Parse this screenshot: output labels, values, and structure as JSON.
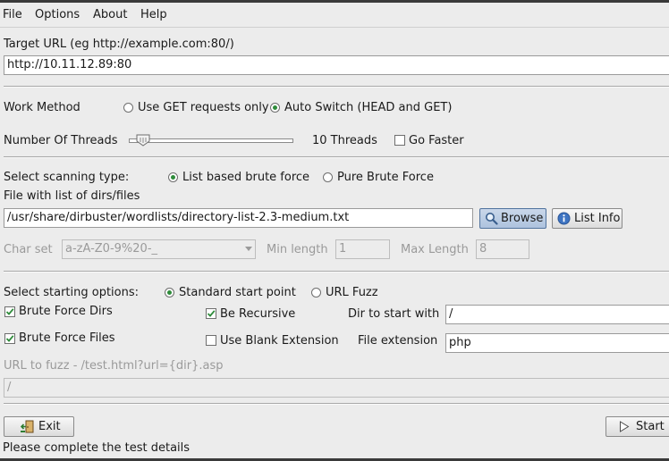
{
  "menu": {
    "file": "File",
    "options": "Options",
    "about": "About",
    "help": "Help"
  },
  "target": {
    "label": "Target URL (eg http://example.com:80/)",
    "value": "http://10.11.12.89:80"
  },
  "work_method": {
    "label": "Work Method",
    "get_only": "Use GET requests only",
    "auto_switch": "Auto Switch (HEAD and GET)",
    "selected": "auto_switch"
  },
  "threads": {
    "label": "Number Of Threads",
    "value_text": "10 Threads",
    "go_faster": "Go Faster",
    "go_faster_checked": false,
    "slider_fraction": 0.09
  },
  "scan_type": {
    "label": "Select scanning type:",
    "list_based": "List based brute force",
    "pure_brute": "Pure Brute Force",
    "selected": "list_based"
  },
  "wordlist": {
    "label": "File with list of dirs/files",
    "value": "/usr/share/dirbuster/wordlists/directory-list-2.3-medium.txt",
    "browse": "Browse",
    "list_info": "List Info"
  },
  "brute": {
    "charset_label": "Char set",
    "charset_value": "a-zA-Z0-9%20-_",
    "min_label": "Min length",
    "min_value": "1",
    "max_label": "Max Length",
    "max_value": "8"
  },
  "start_options": {
    "label": "Select starting options:",
    "standard": "Standard start point",
    "url_fuzz": "URL Fuzz",
    "selected": "standard"
  },
  "options": {
    "brute_dirs": "Brute Force Dirs",
    "brute_dirs_checked": true,
    "brute_files": "Brute Force Files",
    "brute_files_checked": true,
    "recursive": "Be Recursive",
    "recursive_checked": true,
    "blank_ext": "Use Blank Extension",
    "blank_ext_checked": false,
    "dir_start_label": "Dir to start with",
    "dir_start_value": "/",
    "file_ext_label": "File extension",
    "file_ext_value": "php"
  },
  "fuzz": {
    "label": "URL to fuzz - /test.html?url={dir}.asp",
    "value": "/"
  },
  "buttons": {
    "exit": "Exit",
    "start": "Start"
  },
  "status": "Please complete the test details",
  "icons": {
    "browse": "magnifier-icon",
    "list_info": "info-icon",
    "exit": "exit-door-icon",
    "start": "play-triangle-icon"
  }
}
